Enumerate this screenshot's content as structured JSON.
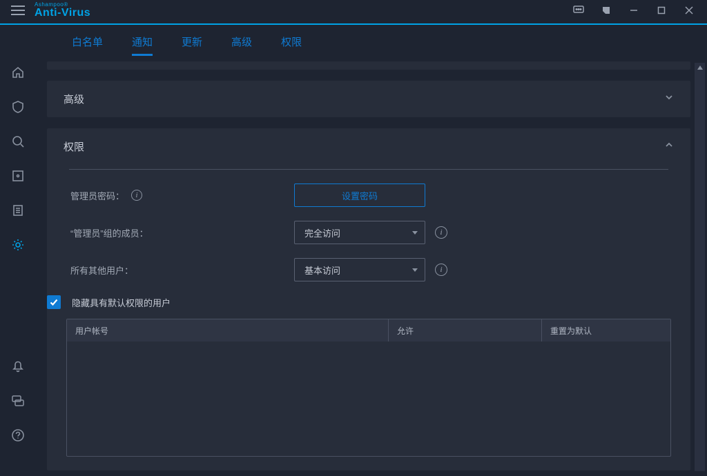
{
  "brand": {
    "top": "Ashampoo®",
    "name": "Anti-Virus"
  },
  "tabs": [
    {
      "label": "白名单"
    },
    {
      "label": "通知"
    },
    {
      "label": "更新"
    },
    {
      "label": "高级"
    },
    {
      "label": "权限"
    }
  ],
  "active_tab_index": 1,
  "sections": {
    "advanced_title": "高级",
    "perm_title": "权限"
  },
  "perm": {
    "admin_pw_label": "管理员密码：",
    "set_pw_btn": "设置密码",
    "admin_group_label": "“管理员”组的成员：",
    "admin_group_value": "完全访问",
    "others_label": "所有其他用户：",
    "others_value": "基本访问",
    "hide_default_label": "隐藏具有默认权限的用户"
  },
  "table": {
    "col_account": "用户帐号",
    "col_allow": "允许",
    "col_reset": "重置为默认"
  }
}
